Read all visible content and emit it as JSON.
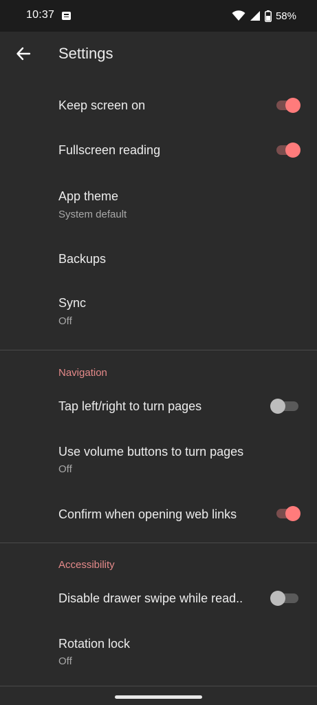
{
  "status_bar": {
    "time": "10:37",
    "battery_percent": "58%"
  },
  "toolbar": {
    "title": "Settings"
  },
  "general": [
    {
      "title": "Keep screen on",
      "toggle": true
    },
    {
      "title": "Fullscreen reading",
      "toggle": true
    },
    {
      "title": "App theme",
      "summary": "System default"
    },
    {
      "title": "Backups"
    },
    {
      "title": "Sync",
      "summary": "Off"
    }
  ],
  "navigation": {
    "header": "Navigation",
    "items": [
      {
        "title": "Tap left/right to turn pages",
        "toggle": false
      },
      {
        "title": "Use volume buttons to turn pages",
        "summary": "Off"
      },
      {
        "title": "Confirm when opening web links",
        "toggle": true
      }
    ]
  },
  "accessibility": {
    "header": "Accessibility",
    "items": [
      {
        "title": "Disable drawer swipe while read..",
        "toggle": false
      },
      {
        "title": "Rotation lock",
        "summary": "Off"
      }
    ]
  },
  "colors": {
    "accent": "#ff7b7b",
    "section_header": "#e58a8a",
    "background": "#2b2b2b"
  }
}
